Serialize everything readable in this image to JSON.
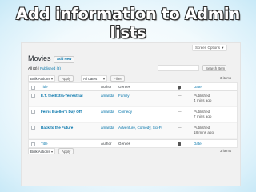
{
  "slide": {
    "title": "Add information to Admin lists"
  },
  "screen_options": {
    "label": "Screen Options",
    "caret": "▾"
  },
  "page": {
    "title": "Movies",
    "add_new": "Add New"
  },
  "filters_links": {
    "all": "All (3)",
    "sep": " | ",
    "published": "Published (3)"
  },
  "search": {
    "placeholder": "",
    "button": "Search Item"
  },
  "toolbar": {
    "bulk_actions": "Bulk Actions",
    "apply": "Apply",
    "dates": "All dates",
    "filter": "Filter",
    "caret": "▾"
  },
  "pagination": {
    "items_top": "3 items",
    "items_bottom": "3 items"
  },
  "columns": {
    "title": "Title",
    "author": "Author",
    "genres": "Genres",
    "comments_icon": "comment-icon",
    "date": "Date"
  },
  "rows": [
    {
      "title": "E.T. the Extra-Terrestrial",
      "author": "amanda",
      "genres": "Family",
      "comments": "—",
      "status": "Published",
      "when": "4 mins ago"
    },
    {
      "title": "Ferris Bueller's Day Off",
      "author": "amanda",
      "genres": "Comedy",
      "comments": "—",
      "status": "Published",
      "when": "7 mins ago"
    },
    {
      "title": "Back to the Future",
      "author": "amanda",
      "genres": "Adventure, Comedy, Sci-Fi",
      "comments": "—",
      "status": "Published",
      "when": "18 mins ago"
    }
  ],
  "colors": {
    "link": "#0073aa",
    "title_fill": "#ffffff",
    "title_stroke": "#2e2e2e",
    "background_edge": "#c8e9f7"
  }
}
